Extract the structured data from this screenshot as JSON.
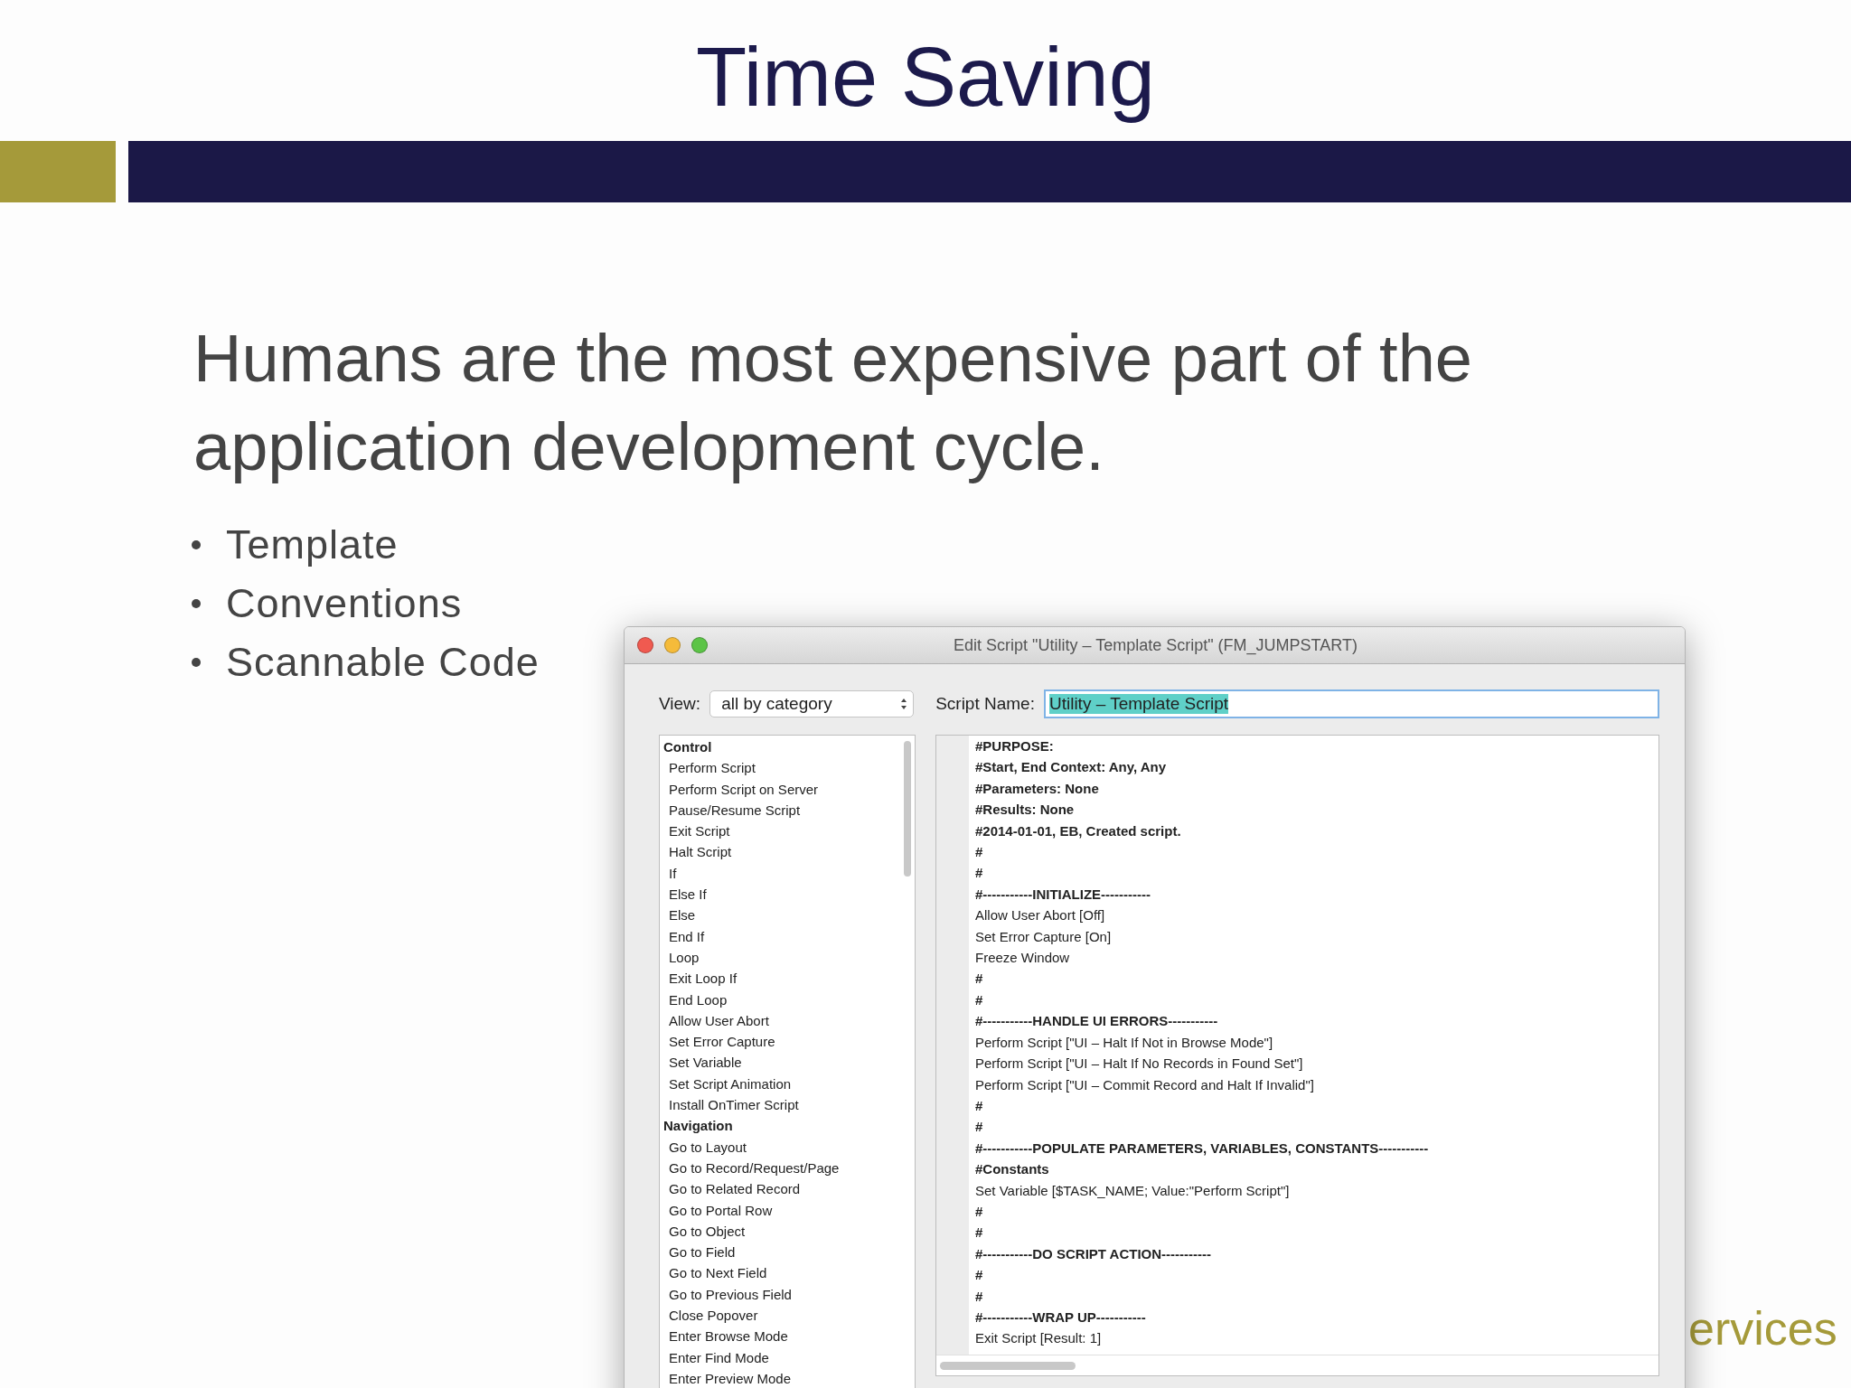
{
  "slide": {
    "title": "Time Saving",
    "heading": "Humans are the most expensive part of the application development cycle.",
    "bullets": [
      "Template",
      "Conventions",
      "Scannable Code"
    ],
    "footer_text": "ervices"
  },
  "window": {
    "title": "Edit Script \"Utility – Template Script\" (FM_JUMPSTART)",
    "view_label": "View:",
    "view_value": "all by category",
    "script_name_label": "Script Name:",
    "script_name_value": "Utility – Template Script",
    "script_name_selected": true,
    "steps": [
      {
        "label": "Control",
        "kind": "category"
      },
      {
        "label": "Perform Script",
        "kind": "step"
      },
      {
        "label": "Perform Script on Server",
        "kind": "step"
      },
      {
        "label": "Pause/Resume Script",
        "kind": "step"
      },
      {
        "label": "Exit Script",
        "kind": "step"
      },
      {
        "label": "Halt Script",
        "kind": "step"
      },
      {
        "label": "If",
        "kind": "step"
      },
      {
        "label": "Else If",
        "kind": "step"
      },
      {
        "label": "Else",
        "kind": "step"
      },
      {
        "label": "End If",
        "kind": "step"
      },
      {
        "label": "Loop",
        "kind": "step"
      },
      {
        "label": "Exit Loop If",
        "kind": "step"
      },
      {
        "label": "End Loop",
        "kind": "step"
      },
      {
        "label": "Allow User Abort",
        "kind": "step"
      },
      {
        "label": "Set Error Capture",
        "kind": "step"
      },
      {
        "label": "Set Variable",
        "kind": "step"
      },
      {
        "label": "Set Script Animation",
        "kind": "step"
      },
      {
        "label": "Install OnTimer Script",
        "kind": "step"
      },
      {
        "label": "Navigation",
        "kind": "category"
      },
      {
        "label": "Go to Layout",
        "kind": "step"
      },
      {
        "label": "Go to Record/Request/Page",
        "kind": "step"
      },
      {
        "label": "Go to Related Record",
        "kind": "step"
      },
      {
        "label": "Go to Portal Row",
        "kind": "step"
      },
      {
        "label": "Go to Object",
        "kind": "step"
      },
      {
        "label": "Go to Field",
        "kind": "step"
      },
      {
        "label": "Go to Next Field",
        "kind": "step"
      },
      {
        "label": "Go to Previous Field",
        "kind": "step"
      },
      {
        "label": "Close Popover",
        "kind": "step"
      },
      {
        "label": "Enter Browse Mode",
        "kind": "step"
      },
      {
        "label": "Enter Find Mode",
        "kind": "step"
      },
      {
        "label": "Enter Preview Mode",
        "kind": "step"
      }
    ],
    "script_lines": [
      {
        "text": "#PURPOSE:",
        "kind": "comment"
      },
      {
        "text": "#Start, End Context: Any, Any",
        "kind": "comment"
      },
      {
        "text": "#Parameters: None",
        "kind": "comment"
      },
      {
        "text": "#Results: None",
        "kind": "comment"
      },
      {
        "text": "#2014-01-01, EB, Created script.",
        "kind": "comment"
      },
      {
        "text": "#",
        "kind": "comment"
      },
      {
        "text": "#",
        "kind": "comment"
      },
      {
        "text": "#-----------INITIALIZE-----------",
        "kind": "comment"
      },
      {
        "text": "Allow User Abort [Off]",
        "kind": "step"
      },
      {
        "text": "Set Error Capture [On]",
        "kind": "step"
      },
      {
        "text": "Freeze Window",
        "kind": "step"
      },
      {
        "text": "#",
        "kind": "comment"
      },
      {
        "text": "#",
        "kind": "comment"
      },
      {
        "text": "#-----------HANDLE UI ERRORS-----------",
        "kind": "comment"
      },
      {
        "text": "Perform Script [\"UI – Halt If Not in Browse Mode\"]",
        "kind": "step"
      },
      {
        "text": "Perform Script [\"UI – Halt If No Records in Found Set\"]",
        "kind": "step"
      },
      {
        "text": "Perform Script [\"UI – Commit Record and Halt If Invalid\"]",
        "kind": "step"
      },
      {
        "text": "#",
        "kind": "comment"
      },
      {
        "text": "#",
        "kind": "comment"
      },
      {
        "text": "#-----------POPULATE PARAMETERS, VARIABLES, CONSTANTS-----------",
        "kind": "comment"
      },
      {
        "text": "#Constants",
        "kind": "comment"
      },
      {
        "text": "Set Variable [$TASK_NAME; Value:\"Perform Script\"]",
        "kind": "step"
      },
      {
        "text": "#",
        "kind": "comment"
      },
      {
        "text": "#",
        "kind": "comment"
      },
      {
        "text": "#-----------DO SCRIPT ACTION-----------",
        "kind": "comment"
      },
      {
        "text": "#",
        "kind": "comment"
      },
      {
        "text": "#",
        "kind": "comment"
      },
      {
        "text": "#-----------WRAP UP-----------",
        "kind": "comment"
      },
      {
        "text": "Exit Script [Result: 1]",
        "kind": "step"
      }
    ]
  }
}
